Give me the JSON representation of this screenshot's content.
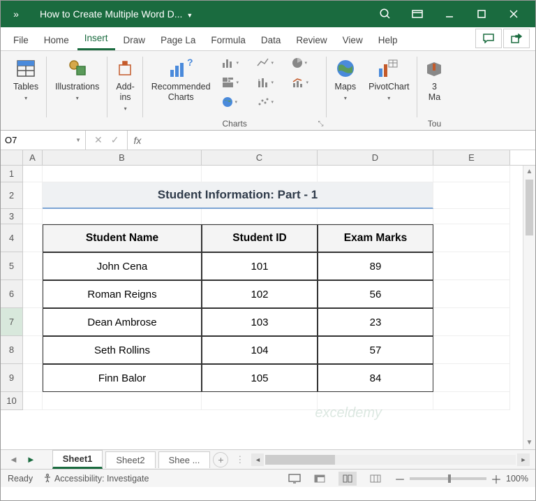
{
  "titlebar": {
    "chev_label": "»",
    "title": "How to Create Multiple Word D..."
  },
  "ribbon_tabs": [
    "File",
    "Home",
    "Insert",
    "Draw",
    "Page La",
    "Formula",
    "Data",
    "Review",
    "View",
    "Help"
  ],
  "active_tab": "Insert",
  "ribbon": {
    "tables": "Tables",
    "illustrations": "Illustrations",
    "addins": "Add-\nins",
    "rec_charts": "Recommended\nCharts",
    "charts_label": "Charts",
    "maps": "Maps",
    "pivotchart": "PivotChart",
    "threed": "3\nMa",
    "tours": "Tou"
  },
  "namebox": "O7",
  "fx": "fx",
  "columns": [
    "A",
    "B",
    "C",
    "D",
    "E"
  ],
  "rows": [
    "1",
    "2",
    "3",
    "4",
    "5",
    "6",
    "7",
    "8",
    "9",
    "10"
  ],
  "sheet": {
    "title": "Student Information: Part - 1",
    "headers": [
      "Student Name",
      "Student ID",
      "Exam Marks"
    ],
    "data": [
      [
        "John Cena",
        "101",
        "89"
      ],
      [
        "Roman Reigns",
        "102",
        "56"
      ],
      [
        "Dean Ambrose",
        "103",
        "23"
      ],
      [
        "Seth Rollins",
        "104",
        "57"
      ],
      [
        "Finn Balor",
        "105",
        "84"
      ]
    ]
  },
  "sheet_tabs": [
    "Sheet1",
    "Sheet2",
    "Shee ..."
  ],
  "status": {
    "ready": "Ready",
    "accessibility": "Accessibility: Investigate",
    "zoom": "100%"
  },
  "watermark": "exceldemy",
  "chart_data": {
    "type": "table",
    "title": "Student Information: Part - 1",
    "columns": [
      "Student Name",
      "Student ID",
      "Exam Marks"
    ],
    "rows": [
      [
        "John Cena",
        101,
        89
      ],
      [
        "Roman Reigns",
        102,
        56
      ],
      [
        "Dean Ambrose",
        103,
        23
      ],
      [
        "Seth Rollins",
        104,
        57
      ],
      [
        "Finn Balor",
        105,
        84
      ]
    ]
  }
}
